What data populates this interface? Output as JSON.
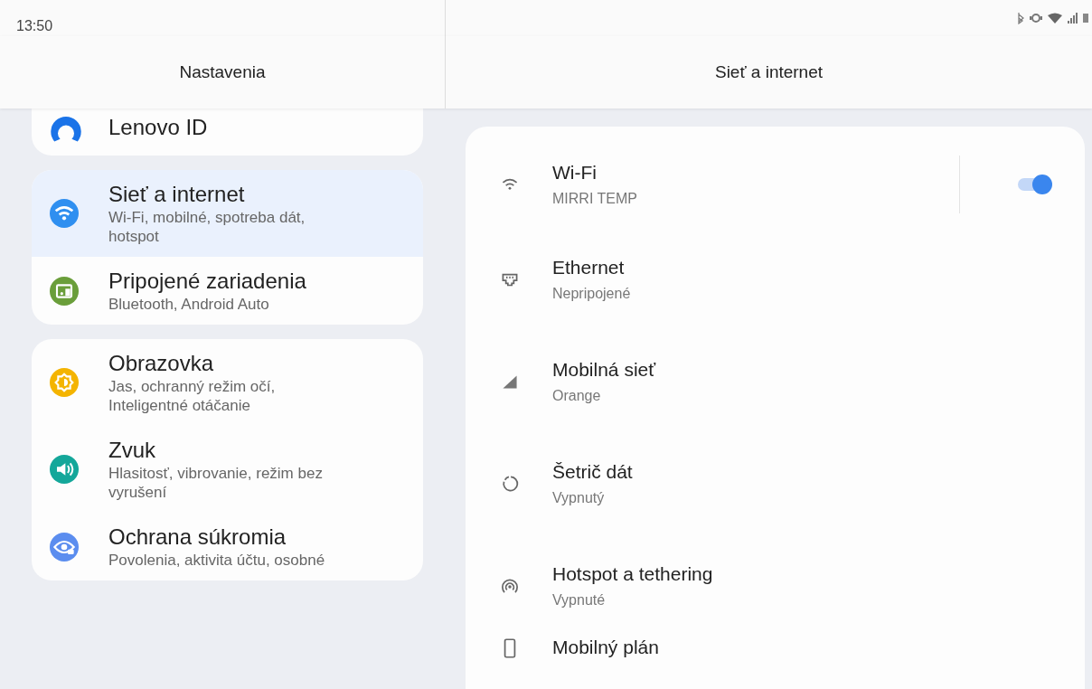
{
  "status_bar": {
    "time": "13:50"
  },
  "left_pane": {
    "title": "Nastavenia",
    "groups": [
      [
        {
          "title": "Lenovo ID",
          "color": "#1a73e8",
          "selected": false
        }
      ],
      [
        {
          "title": "Sieť a internet",
          "subtitle": "Wi-Fi, mobilné, spotreba dát, hotspot",
          "color": "#2f8ff0",
          "selected": true
        },
        {
          "title": "Pripojené zariadenia",
          "subtitle": "Bluetooth, Android Auto",
          "color": "#6a9e3a",
          "selected": false
        }
      ],
      [
        {
          "title": "Obrazovka",
          "subtitle": "Jas, ochranný režim očí, Inteligentné otáčanie",
          "color": "#f4b400",
          "selected": false
        },
        {
          "title": "Zvuk",
          "subtitle": "Hlasitosť, vibrovanie, režim bez vyrušení",
          "color": "#14a79a",
          "selected": false
        },
        {
          "title": "Ochrana súkromia",
          "subtitle": "Povolenia, aktivita účtu, osobné",
          "color": "#5b8def",
          "selected": false
        }
      ]
    ]
  },
  "right_pane": {
    "title": "Sieť a internet",
    "items": [
      {
        "title": "Wi-Fi",
        "subtitle": "MIRRI TEMP",
        "toggle": {
          "on": true
        }
      },
      {
        "title": "Ethernet",
        "subtitle": "Nepripojené"
      },
      {
        "title": "Mobilná sieť",
        "subtitle": "Orange"
      },
      {
        "title": "Šetrič dát",
        "subtitle": "Vypnutý"
      },
      {
        "title": "Hotspot a tethering",
        "subtitle": "Vypnuté"
      },
      {
        "title": "Mobilný plán"
      }
    ]
  }
}
